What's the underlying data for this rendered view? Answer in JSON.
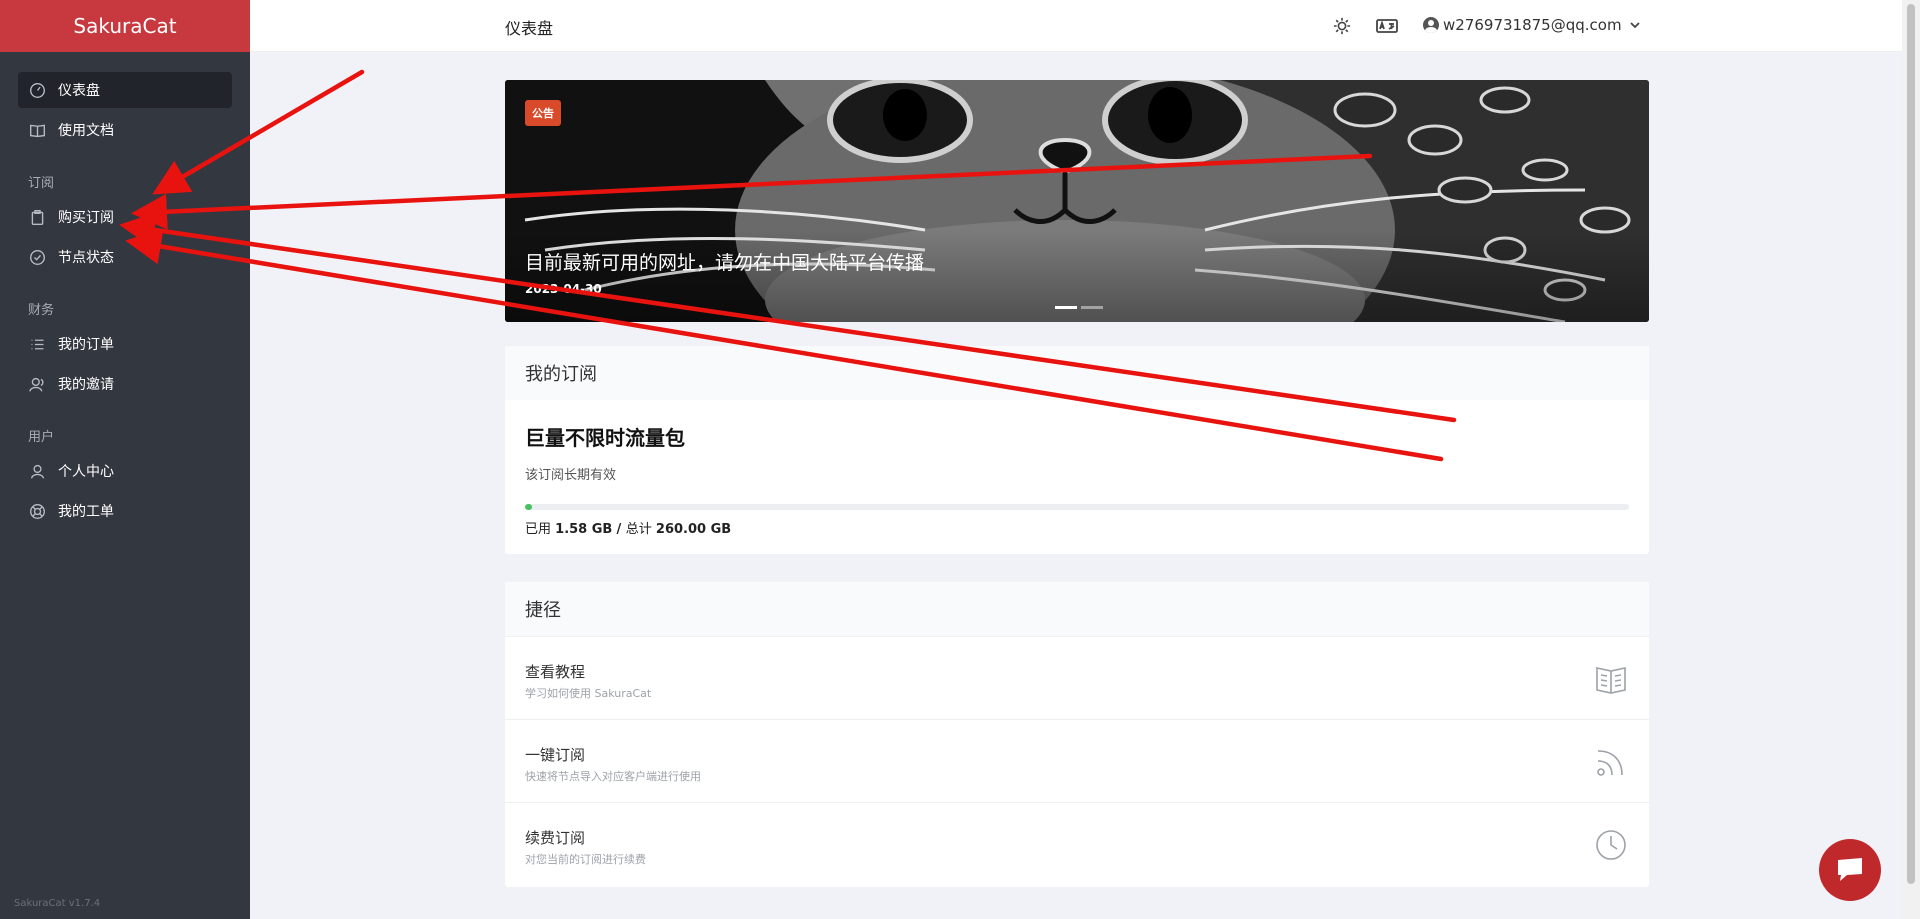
{
  "app": {
    "brand": "SakuraCat",
    "version": "SakuraCat v1.7.4"
  },
  "sidebar": {
    "items": [
      {
        "label": "仪表盘",
        "icon": "speedometer-icon",
        "active": true
      },
      {
        "label": "使用文档",
        "icon": "book-icon"
      }
    ],
    "sections": [
      {
        "heading": "订阅",
        "items": [
          {
            "label": "购买订阅",
            "icon": "clipboard-icon"
          },
          {
            "label": "节点状态",
            "icon": "check-circle-icon"
          }
        ]
      },
      {
        "heading": "财务",
        "items": [
          {
            "label": "我的订单",
            "icon": "list-icon"
          },
          {
            "label": "我的邀请",
            "icon": "users-icon"
          }
        ]
      },
      {
        "heading": "用户",
        "items": [
          {
            "label": "个人中心",
            "icon": "user-icon"
          },
          {
            "label": "我的工单",
            "icon": "lifebuoy-icon"
          }
        ]
      }
    ]
  },
  "header": {
    "title": "仪表盘",
    "user_email": "w2769731875@qq.com"
  },
  "banner": {
    "badge": "公告",
    "title": "目前最新可用的网址，请勿在中国大陆平台传播",
    "date": "2023-04-30",
    "slides": 2,
    "active_slide": 1
  },
  "subscription": {
    "heading": "我的订阅",
    "plan_name": "巨量不限时流量包",
    "validity": "该订阅长期有效",
    "used_label": "已用",
    "used": "1.58 GB",
    "total_label": "总计",
    "total": "260.00 GB",
    "usage_fraction": 0.006,
    "progress_color": "#46c35f"
  },
  "shortcuts": {
    "heading": "捷径",
    "items": [
      {
        "title": "查看教程",
        "desc": "学习如何使用 SakuraCat",
        "icon": "book-open-icon"
      },
      {
        "title": "一键订阅",
        "desc": "快速将节点导入对应客户端进行使用",
        "icon": "rss-icon"
      },
      {
        "title": "续费订阅",
        "desc": "对您当前的订阅进行续费",
        "icon": "clock-icon"
      }
    ]
  },
  "colors": {
    "brand": "#c8393f",
    "sidebar": "#33373f",
    "annotation": "#e8130f"
  }
}
